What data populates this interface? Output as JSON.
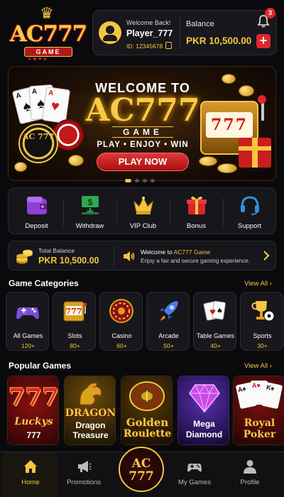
{
  "brand": {
    "logo_main": "AC777",
    "logo_sub": "GAME"
  },
  "user": {
    "welcome": "Welcome Back!",
    "username": "Player_777",
    "id_text": "ID: 12345678",
    "balance_label": "Balance",
    "balance_value": "PKR 10,500.00",
    "notification_count": "3"
  },
  "banner": {
    "title": "WELCOME TO",
    "brand": "AC777",
    "game": "GAME",
    "tagline": "PLAY • ENJOY • WIN",
    "cta": "PLAY NOW",
    "chip_text": "AC 777",
    "slot_text": "777",
    "slide_count": 4,
    "active_slide": 1
  },
  "quick_actions": [
    {
      "label": "Deposit",
      "icon": "wallet-icon"
    },
    {
      "label": "Withdraw",
      "icon": "cash-icon"
    },
    {
      "label": "VIP Club",
      "icon": "crown-icon"
    },
    {
      "label": "Bonus",
      "icon": "gift-icon"
    },
    {
      "label": "Support",
      "icon": "headset-icon"
    }
  ],
  "info_bar": {
    "total_label": "Total Balance",
    "total_value": "PKR 10,500.00",
    "announce_prefix": "Welcome to ",
    "announce_brand": "AC777 Game",
    "announce_sub": "Enjoy a fair and secure gaming experience."
  },
  "categories_section": {
    "title": "Game Categories",
    "view_all": "View All"
  },
  "categories": [
    {
      "name": "All Games",
      "count": "120+",
      "icon": "gamepad-icon"
    },
    {
      "name": "Slots",
      "count": "80+",
      "icon": "slot-machine-icon"
    },
    {
      "name": "Casino",
      "count": "60+",
      "icon": "roulette-icon"
    },
    {
      "name": "Arcade",
      "count": "50+",
      "icon": "rocket-icon"
    },
    {
      "name": "Table Games",
      "count": "40+",
      "icon": "cards-icon"
    },
    {
      "name": "Sports",
      "count": "30+",
      "icon": "trophy-icon"
    }
  ],
  "popular_section": {
    "title": "Popular Games",
    "view_all": "View All"
  },
  "games": [
    {
      "art_line1": "777",
      "art_line2": "Luckys",
      "title": "777",
      "title2": ""
    },
    {
      "art_line1": "DRAGON",
      "art_line2": "",
      "title": "Dragon",
      "title2": "Treasure"
    },
    {
      "art_line1": "",
      "art_line2": "",
      "title": "Golden",
      "title2": "Roulette"
    },
    {
      "art_line1": "",
      "art_line2": "",
      "title": "Mega",
      "title2": "Diamond"
    },
    {
      "art_line1": "",
      "art_line2": "",
      "title": "Royal",
      "title2": "Poker"
    }
  ],
  "nav": [
    {
      "label": "Home",
      "icon": "home-icon",
      "active": true
    },
    {
      "label": "Promotions",
      "icon": "megaphone-icon",
      "active": false
    },
    {
      "label": "",
      "icon": "ac777-logo",
      "active": false
    },
    {
      "label": "My Games",
      "icon": "gamepad-icon",
      "active": false
    },
    {
      "label": "Profile",
      "icon": "person-icon",
      "active": false
    }
  ],
  "nav_center": {
    "line1": "AC",
    "line2": "777"
  },
  "colors": {
    "gold": "#f5c542",
    "red": "#e0262b",
    "background": "#0a0a0d",
    "card": "#17171c"
  }
}
